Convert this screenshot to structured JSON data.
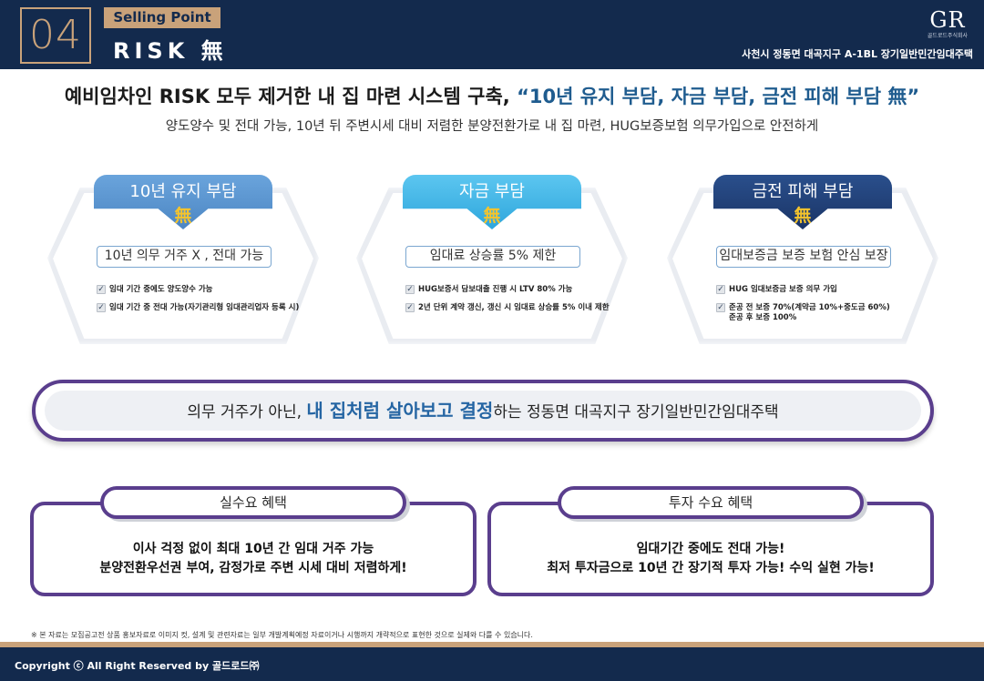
{
  "header": {
    "number": "04",
    "badge": "Selling Point",
    "title": "RISK 無",
    "logo_mark": "GR",
    "logo_sub": "골드로드주식회사",
    "site_name": "사천시 정동면 대곡지구 A-1BL 장기일반민간임대주택"
  },
  "headline": {
    "prefix": "예비임차인 RISK 모두 제거한 내 집 마련 시스템 구축, ",
    "highlight": "“10년 유지 부담, 자금 부담, 금전 피해 부담 無”",
    "subline": "양도양수 및 전대 가능, 10년 뒤 주변시세 대비 저렴한 분양전환가로 내 집 마련, HUG보증보험 의무가입으로 안전하게"
  },
  "cards": [
    {
      "title": "10년 유지 부담",
      "mu": "無",
      "pill": "10년 의무 거주 X , 전대 가능",
      "items": [
        "임대 기간 중에도 양도양수 가능",
        "임대 기간 중 전대 가능(자기관리형 임대관리업자 등록 시)"
      ],
      "color": "#5b96d1"
    },
    {
      "title": "자금 부담",
      "mu": "無",
      "pill": "임대료 상승률 5% 제한",
      "items": [
        "HUG보증서 담보대출 진행 시 LTV 80% 가능",
        "2년 단위 계약 갱신, 갱신 시 임대료 상승률 5% 이내 제한"
      ],
      "color": "#3db3e6"
    },
    {
      "title": "금전 피해 부담",
      "mu": "無",
      "pill": "임대보증금 보증 보험 안심 보장",
      "items": [
        "HUG 임대보증금 보증 의무 가입",
        "준공 전 보증 70%(계약금 10%+중도금 60%)\n준공 후 보증 100%"
      ],
      "color": "#1f3e73"
    }
  ],
  "banner": {
    "before": "의무 거주가 아닌, ",
    "highlight": "내 집처럼 살아보고 결정",
    "after": "하는 정동면 대곡지구 장기일반민간임대주택"
  },
  "benefits": [
    {
      "title": "실수요 혜택",
      "line1": "이사 걱정 없이 최대 10년 간 임대 거주 가능",
      "line2": "분양전환우선권 부여, 감정가로 주변 시세 대비 저렴하게!"
    },
    {
      "title": "투자 수요 혜택",
      "line1": "임대기간 중에도 전대 가능!",
      "line2": "최저 투자금으로 10년 간 장기적 투자 가능! 수익 실현 가능!"
    }
  ],
  "disclaimer": "※ 본 자료는 모집공고전 상품 홍보자료로 이미지 컷, 설계 및 관련자료는 일부 개발계획예정 자료이거나 시행까지 개략적으로 표현한 것으로 실제와 다를 수 있습니다.",
  "footer": {
    "copyright": "Copyright ⓒ All Right Reserved by 골드로드㈜"
  },
  "colors": {
    "navy": "#132a4d",
    "gold": "#c9a27a",
    "purple": "#5a3e8d",
    "highlight_blue": "#1f5c8f"
  }
}
